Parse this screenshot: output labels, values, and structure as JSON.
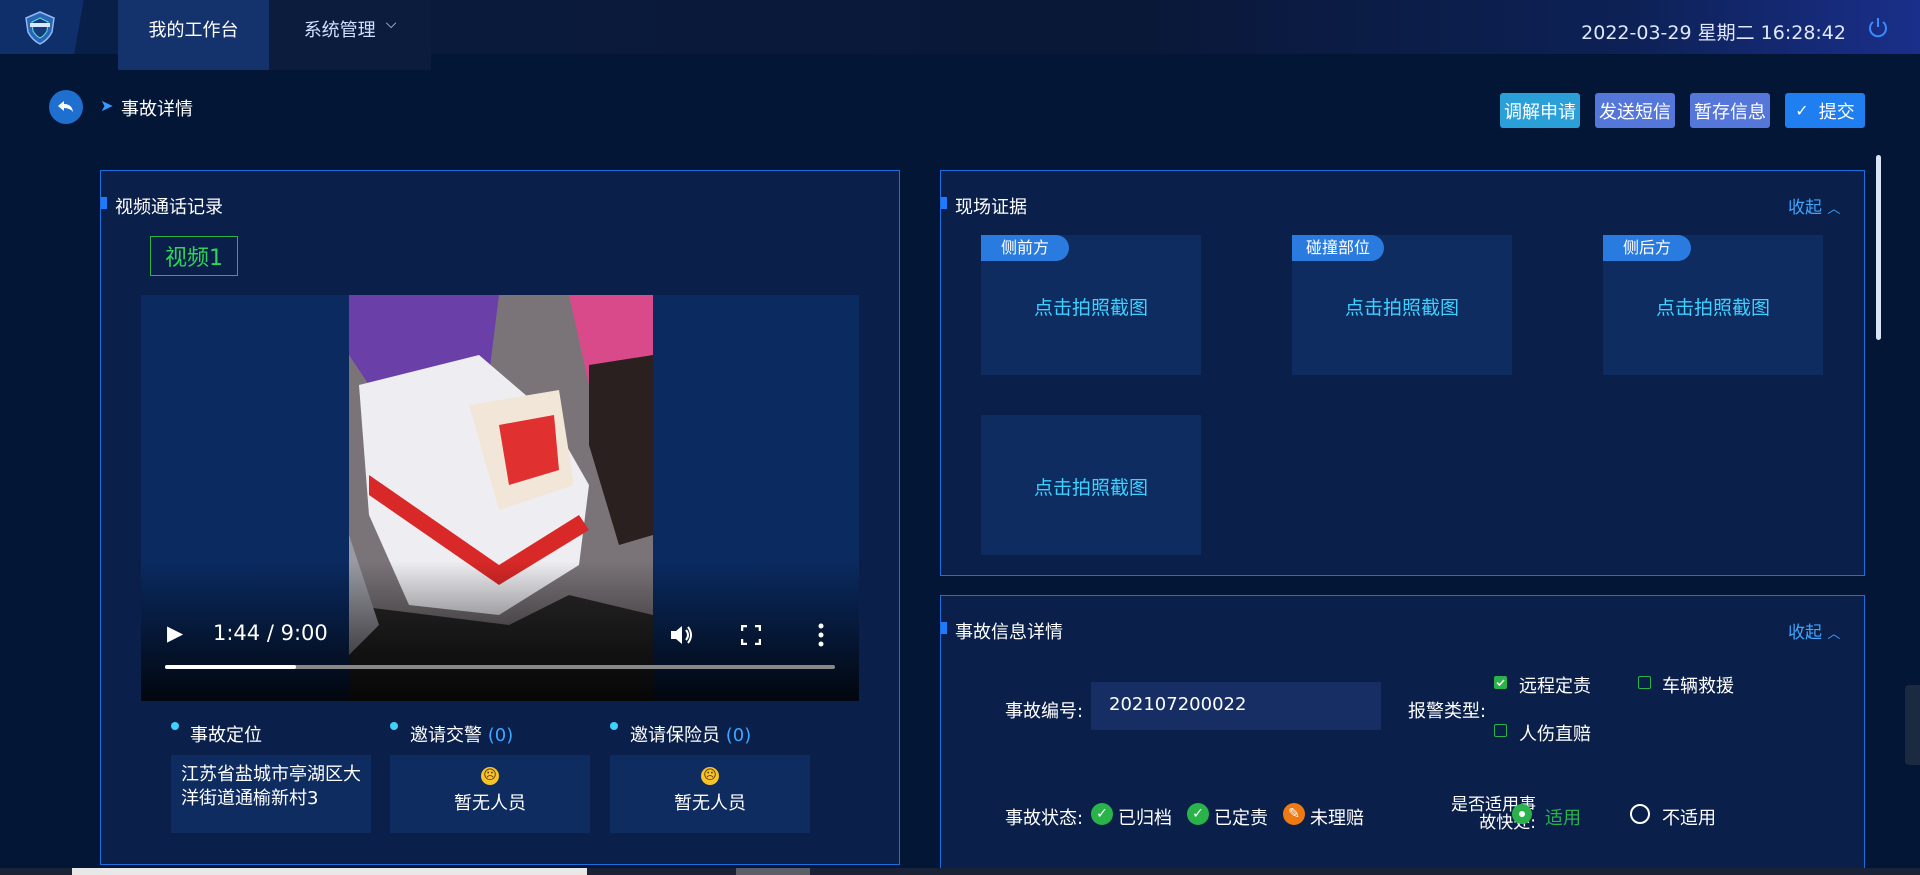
{
  "topbar": {
    "tabs": [
      {
        "label": "我的工作台",
        "active": true
      },
      {
        "label": "系统管理",
        "active": false
      }
    ],
    "datetime": "2022-03-29 星期二 16:28:42"
  },
  "header": {
    "breadcrumb": "事故详情",
    "actions": {
      "mediate": "调解申请",
      "sms": "发送短信",
      "save": "暂存信息",
      "submit": "提交"
    }
  },
  "video_panel": {
    "title": "视频通话记录",
    "video_tag": "视频1",
    "player": {
      "time": "1:44 / 9:00",
      "progress": 0.195
    },
    "location": {
      "label": "事故定位",
      "address": "江苏省盐城市亭湖区大洋街道通榆新村3"
    },
    "traffic_police": {
      "label": "邀请交警",
      "count": "(0)",
      "empty": "暂无人员"
    },
    "insurer": {
      "label": "邀请保险员",
      "count": "(0)",
      "empty": "暂无人员"
    }
  },
  "evidence_panel": {
    "title": "现场证据",
    "collapse": "收起",
    "photos": [
      {
        "tag": "侧前方",
        "text": "点击拍照截图"
      },
      {
        "tag": "碰撞部位",
        "text": "点击拍照截图"
      },
      {
        "tag": "侧后方",
        "text": "点击拍照截图"
      },
      {
        "tag": "",
        "text": "点击拍照截图"
      }
    ]
  },
  "detail_panel": {
    "title": "事故信息详情",
    "collapse": "收起",
    "case_no_label": "事故编号:",
    "case_no": "202107200022",
    "alarm_type_label": "报警类型:",
    "alarm_types": [
      {
        "label": "远程定责",
        "checked": true
      },
      {
        "label": "车辆救援",
        "checked": false
      },
      {
        "label": "人伤直赔",
        "checked": false
      }
    ],
    "status_label": "事故状态:",
    "statuses": [
      {
        "label": "已归档",
        "color": "#29b34a"
      },
      {
        "label": "已定责",
        "color": "#29b34a"
      },
      {
        "label": "未理赔",
        "color": "#f07a12"
      }
    ],
    "quick_label_line1": "是否适用事",
    "quick_label_line2": "故快处:",
    "quick_options": [
      {
        "label": "适用",
        "selected": true
      },
      {
        "label": "不适用",
        "selected": false
      }
    ]
  },
  "colors": {
    "background": "#041636",
    "accent": "#1e7bff",
    "link": "#3ea6ff",
    "success": "#29b34a"
  }
}
